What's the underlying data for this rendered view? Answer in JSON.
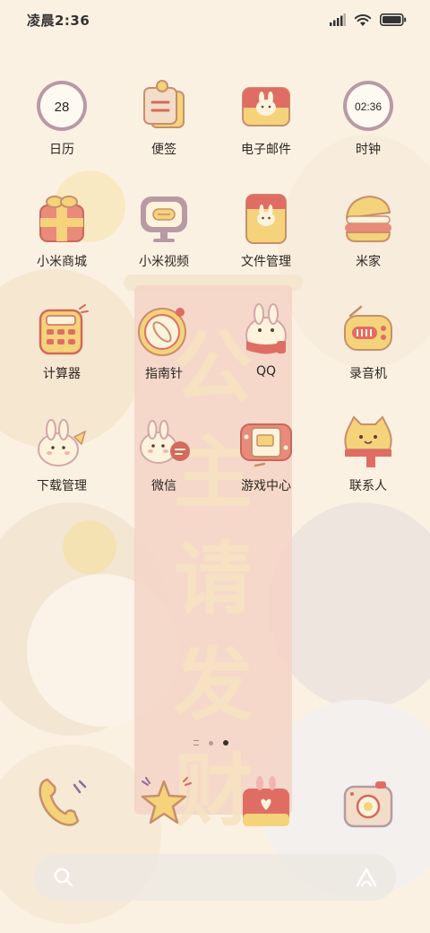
{
  "status_bar": {
    "time": "凌晨2:36",
    "icons": [
      "signal-icon",
      "wifi-icon",
      "battery-icon"
    ]
  },
  "apps": [
    {
      "label": "日历",
      "icon": "calendar-icon",
      "icon_text": "28"
    },
    {
      "label": "便签",
      "icon": "notes-icon"
    },
    {
      "label": "电子邮件",
      "icon": "email-icon"
    },
    {
      "label": "时钟",
      "icon": "clock-icon",
      "icon_text": "02:36"
    },
    {
      "label": "小米商城",
      "icon": "gift-icon"
    },
    {
      "label": "小米视频",
      "icon": "video-icon"
    },
    {
      "label": "文件管理",
      "icon": "file-manager-icon"
    },
    {
      "label": "米家",
      "icon": "smart-home-icon"
    },
    {
      "label": "计算器",
      "icon": "calculator-icon"
    },
    {
      "label": "指南针",
      "icon": "compass-icon"
    },
    {
      "label": "QQ",
      "icon": "qq-icon"
    },
    {
      "label": "录音机",
      "icon": "recorder-icon"
    },
    {
      "label": "下载管理",
      "icon": "download-icon"
    },
    {
      "label": "微信",
      "icon": "wechat-icon"
    },
    {
      "label": "游戏中心",
      "icon": "game-center-icon"
    },
    {
      "label": "联系人",
      "icon": "contacts-icon"
    }
  ],
  "page_indicator": {
    "count": 3,
    "active_index": 2
  },
  "dock": [
    {
      "icon": "phone-icon"
    },
    {
      "icon": "star-icon"
    },
    {
      "icon": "messages-icon"
    },
    {
      "icon": "camera-icon"
    }
  ],
  "search_bar": {
    "icons": [
      "search-icon",
      "assistant-icon"
    ]
  },
  "wallpaper": {
    "banner_text": [
      "公",
      "主",
      "请",
      "发",
      "财"
    ]
  },
  "colors": {
    "background": "#fbf1e3",
    "icon_red": "#e06d64",
    "icon_yellow": "#f4d37b",
    "icon_outline": "#c88f6b",
    "icon_cream": "#fdf3dc",
    "banner": "#f3d4c6"
  }
}
